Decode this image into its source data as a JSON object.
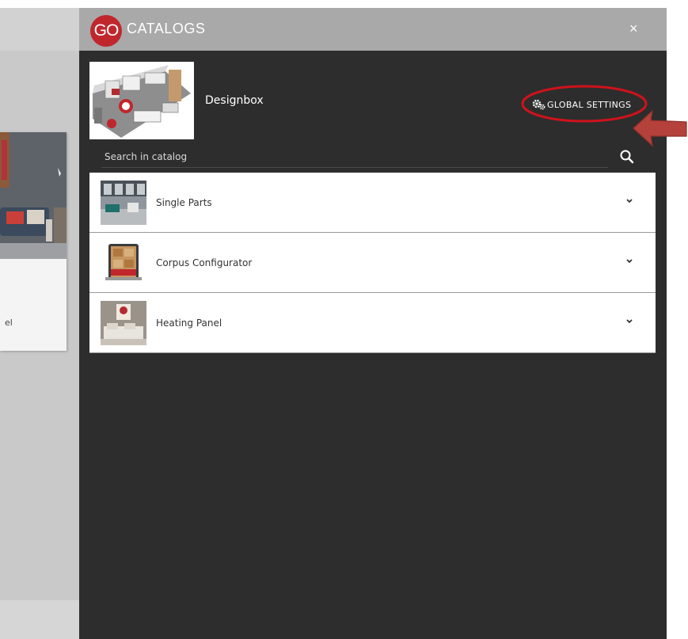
{
  "background": {
    "card_text": "el"
  },
  "panel": {
    "logo_text": "GO",
    "title": "CATALOGS",
    "close_label": "×",
    "catalog_name": "Designbox",
    "global_settings_label": "GLOBAL SETTINGS",
    "search_placeholder": "Search in catalog",
    "items": [
      {
        "label": "Single Parts"
      },
      {
        "label": "Corpus Configurator"
      },
      {
        "label": "Heating Panel"
      }
    ]
  },
  "colors": {
    "brand_red": "#c0272d",
    "panel_bg": "#2d2d2d",
    "header_bg": "#a9a9a9",
    "annotation_red": "#d0121b",
    "arrow_red": "#b5413b"
  }
}
